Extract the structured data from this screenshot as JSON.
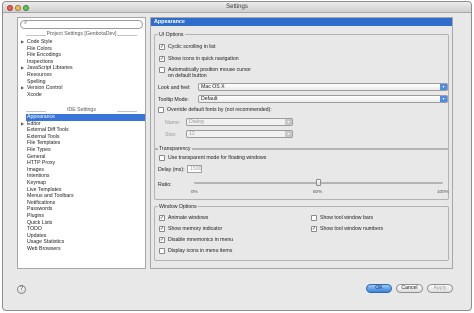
{
  "window": {
    "title": "Settings"
  },
  "search": {
    "placeholder": ""
  },
  "sidebar": {
    "project_header": "Project Settings [GenbotaDev]",
    "project_items": [
      {
        "label": "Code Style",
        "expandable": true
      },
      {
        "label": "File Colors",
        "expandable": false
      },
      {
        "label": "File Encodings",
        "expandable": false
      },
      {
        "label": "Inspections",
        "expandable": false
      },
      {
        "label": "JavaScript Libraries",
        "expandable": true
      },
      {
        "label": "Resources",
        "expandable": false
      },
      {
        "label": "Spelling",
        "expandable": false
      },
      {
        "label": "Version Control",
        "expandable": true
      },
      {
        "label": "Xcode",
        "expandable": false
      }
    ],
    "ide_header": "IDE Settings",
    "ide_items": [
      {
        "label": "Appearance",
        "expandable": false,
        "selected": true
      },
      {
        "label": "Editor",
        "expandable": true
      },
      {
        "label": "External Diff Tools",
        "expandable": false
      },
      {
        "label": "External Tools",
        "expandable": false
      },
      {
        "label": "File Templates",
        "expandable": false
      },
      {
        "label": "File Types",
        "expandable": false
      },
      {
        "label": "General",
        "expandable": false
      },
      {
        "label": "HTTP Proxy",
        "expandable": false
      },
      {
        "label": "Images",
        "expandable": false
      },
      {
        "label": "Intentions",
        "expandable": false
      },
      {
        "label": "Keymap",
        "expandable": false
      },
      {
        "label": "Live Templates",
        "expandable": false
      },
      {
        "label": "Menus and Toolbars",
        "expandable": false
      },
      {
        "label": "Notifications",
        "expandable": false
      },
      {
        "label": "Passwords",
        "expandable": false
      },
      {
        "label": "Plugins",
        "expandable": false
      },
      {
        "label": "Quick Lists",
        "expandable": false
      },
      {
        "label": "TODO",
        "expandable": false
      },
      {
        "label": "Updates",
        "expandable": false
      },
      {
        "label": "Usage Statistics",
        "expandable": false
      },
      {
        "label": "Web Browsers",
        "expandable": false
      }
    ]
  },
  "page": {
    "title": "Appearance",
    "ui_options": {
      "title": "UI Options",
      "cyclic_scrolling": {
        "label": "Cyclic scrolling in list",
        "checked": true
      },
      "show_icons_quick_nav": {
        "label": "Show icons in quick navigation",
        "checked": true
      },
      "auto_position_mouse": {
        "label_line1": "Automatically position mouse cursor",
        "label_line2": "on default button",
        "checked": false
      },
      "look_and_feel": {
        "label": "Look and feel:",
        "value": "Mac OS X"
      },
      "tooltip_mode": {
        "label": "Tooltip Mode:",
        "value": "Default"
      },
      "override_fonts": {
        "label": "Override default fonts by (not recommended):",
        "checked": false
      },
      "font_name": {
        "label": "Name:",
        "value": "Dialog"
      },
      "font_size": {
        "label": "Size:",
        "value": "12"
      }
    },
    "transparency": {
      "title": "Transparency",
      "use_transparent": {
        "label": "Use transparent mode for floating windows",
        "checked": false
      },
      "delay": {
        "label": "Delay (ms):",
        "value": "1500"
      },
      "ratio": {
        "label": "Ratio:",
        "min_label": "0%",
        "mid_label": "50%",
        "max_label": "100%",
        "value_fraction": 0.5
      }
    },
    "window_options": {
      "title": "Window Options",
      "animate_windows": {
        "label": "Animate windows",
        "checked": true
      },
      "show_memory": {
        "label": "Show memory indicator",
        "checked": true
      },
      "disable_mnemonics": {
        "label": "Disable mnemonics in menu",
        "checked": true
      },
      "display_icons_menu": {
        "label": "Display icons in menu items",
        "checked": false
      },
      "show_tool_bars": {
        "label": "Show tool window bars",
        "checked": false
      },
      "show_tool_numbers": {
        "label": "Show tool window numbers",
        "checked": true
      }
    }
  },
  "buttons": {
    "help": "?",
    "ok": "OK",
    "cancel": "Cancel",
    "apply": "Apply"
  }
}
